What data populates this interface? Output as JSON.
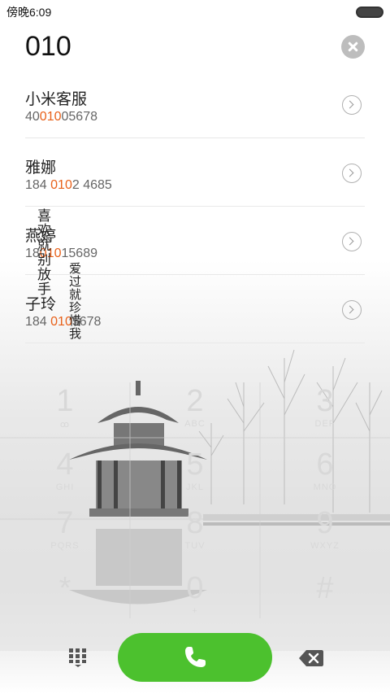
{
  "status": {
    "time": "傍晚6:09"
  },
  "query": "010",
  "results": [
    {
      "name": "小米客服",
      "num_pre": "40",
      "num_hl": "010",
      "num_post": "05678"
    },
    {
      "name": "雅娜",
      "num_pre": "184 ",
      "num_hl": "010",
      "num_post": "2 4685"
    },
    {
      "name": "燕婷",
      "num_pre": "18",
      "num_hl": "010",
      "num_post": "15689"
    },
    {
      "name": "子玲",
      "num_pre": "184 ",
      "num_hl": "010",
      "num_post": "5678"
    }
  ],
  "overlay_text": [
    "喜欢就别放手",
    "爱过就珍惜我"
  ],
  "keypad": [
    {
      "d": "1",
      "l": "ꝏ"
    },
    {
      "d": "2",
      "l": "ABC"
    },
    {
      "d": "3",
      "l": "DEF"
    },
    {
      "d": "4",
      "l": "GHI"
    },
    {
      "d": "5",
      "l": "JKL"
    },
    {
      "d": "6",
      "l": "MNO"
    },
    {
      "d": "7",
      "l": "PQRS"
    },
    {
      "d": "8",
      "l": "TUV"
    },
    {
      "d": "9",
      "l": "WXYZ"
    },
    {
      "d": "*",
      "l": ""
    },
    {
      "d": "0",
      "l": "+"
    },
    {
      "d": "#",
      "l": ""
    }
  ],
  "colors": {
    "accent": "#e8611a",
    "call": "#4cc12e"
  },
  "icons": {
    "call": "phone-icon",
    "dialpad": "dialpad-icon",
    "delete": "backspace-icon",
    "clear": "close-icon"
  }
}
